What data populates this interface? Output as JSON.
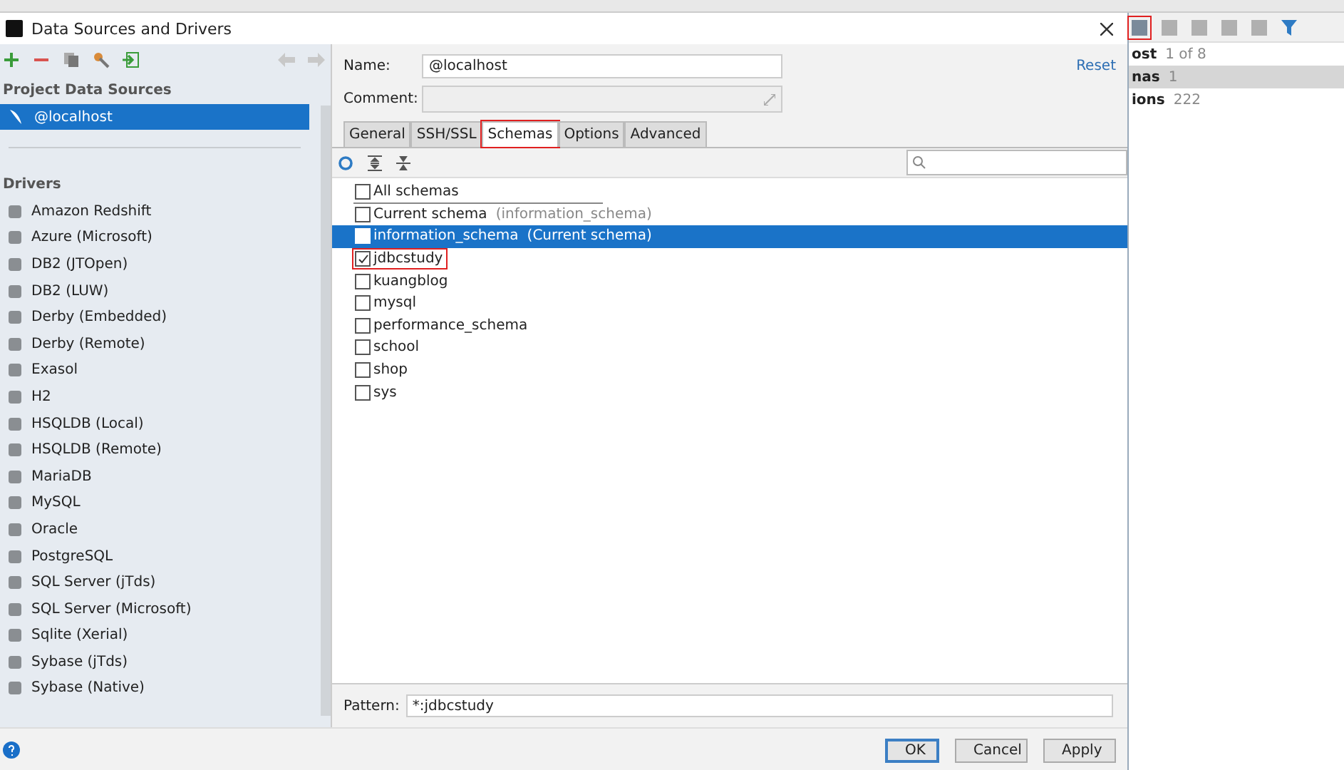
{
  "window": {
    "title": "Data Sources and Drivers"
  },
  "left_toolbar": {
    "buttons": [
      {
        "kind": "add"
      },
      {
        "kind": "remove"
      },
      {
        "kind": "copy"
      },
      {
        "kind": "properties"
      },
      {
        "kind": "import"
      }
    ],
    "nav": [
      {
        "kind": "back"
      },
      {
        "kind": "forward"
      }
    ]
  },
  "project_data_sources": {
    "heading": "Project Data Sources",
    "items": [
      {
        "label": "@localhost",
        "selected": true
      }
    ]
  },
  "drivers": {
    "heading": "Drivers",
    "items": [
      "Amazon Redshift",
      "Azure (Microsoft)",
      "DB2 (JTOpen)",
      "DB2 (LUW)",
      "Derby (Embedded)",
      "Derby (Remote)",
      "Exasol",
      "H2",
      "HSQLDB (Local)",
      "HSQLDB (Remote)",
      "MariaDB",
      "MySQL",
      "Oracle",
      "PostgreSQL",
      "SQL Server (jTds)",
      "SQL Server (Microsoft)",
      "Sqlite (Xerial)",
      "Sybase (jTds)",
      "Sybase (Native)"
    ]
  },
  "form": {
    "name_label": "Name:",
    "name_value": "@localhost",
    "comment_label": "Comment:",
    "reset": "Reset"
  },
  "tabs": [
    {
      "label": "General",
      "selected": false,
      "highlighted": false
    },
    {
      "label": "SSH/SSL",
      "selected": false,
      "highlighted": false
    },
    {
      "label": "Schemas",
      "selected": true,
      "highlighted": true
    },
    {
      "label": "Options",
      "selected": false,
      "highlighted": false
    },
    {
      "label": "Advanced",
      "selected": false,
      "highlighted": false
    }
  ],
  "schemas": [
    {
      "label": "All schemas",
      "checked": false,
      "selected": false,
      "highlighted": false,
      "separator_after": true
    },
    {
      "label": "Current schema",
      "hint": "(information_schema)",
      "checked": false,
      "selected": false,
      "highlighted": false,
      "separator_after": false
    },
    {
      "label": "information_schema",
      "hint": "(Current schema)",
      "checked": false,
      "selected": true,
      "highlighted": false,
      "separator_after": false
    },
    {
      "label": "jdbcstudy",
      "checked": true,
      "selected": false,
      "highlighted": true,
      "separator_after": false
    },
    {
      "label": "kuangblog",
      "checked": false,
      "selected": false,
      "highlighted": false,
      "separator_after": false
    },
    {
      "label": "mysql",
      "checked": false,
      "selected": false,
      "highlighted": false,
      "separator_after": false
    },
    {
      "label": "performance_schema",
      "checked": false,
      "selected": false,
      "highlighted": false,
      "separator_after": false
    },
    {
      "label": "school",
      "checked": false,
      "selected": false,
      "highlighted": false,
      "separator_after": false
    },
    {
      "label": "shop",
      "checked": false,
      "selected": false,
      "highlighted": false,
      "separator_after": false
    },
    {
      "label": "sys",
      "checked": false,
      "selected": false,
      "highlighted": false,
      "separator_after": false
    }
  ],
  "pattern": {
    "label": "Pattern:",
    "value": "*:jdbcstudy"
  },
  "buttons": [
    {
      "label": "OK",
      "kind": "default"
    },
    {
      "label": "Cancel",
      "kind": "normal"
    },
    {
      "label": "Apply",
      "kind": "normal"
    }
  ],
  "background": {
    "rows": [
      {
        "label": "ost",
        "count": "1 of 8",
        "selected": false
      },
      {
        "label": "nas",
        "count": "1",
        "selected": true
      },
      {
        "label": "ions",
        "count": "222",
        "selected": false
      }
    ]
  }
}
